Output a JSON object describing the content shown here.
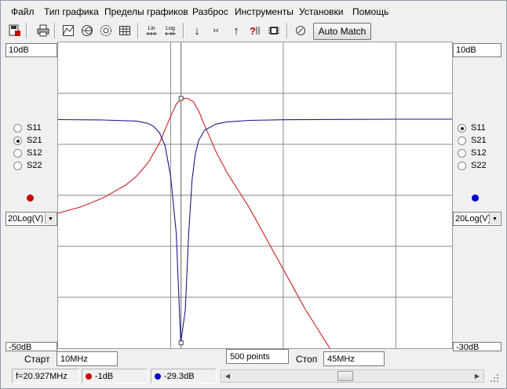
{
  "menu": [
    "Файл",
    "Тип графика",
    "Пределы графиков",
    "Разброс",
    "Инструменты",
    "Установки",
    "Помощь"
  ],
  "toolbar": {
    "auto_match": "Auto Match",
    "lin": "Lin",
    "log": "Log",
    "zoom": "?",
    "arrows": [
      "↓",
      "›‹",
      "↑"
    ]
  },
  "left": {
    "top_scale": "10dB",
    "bottom_scale": "-50dB",
    "params": [
      "S11",
      "S21",
      "S12",
      "S22"
    ],
    "selected": "S21",
    "marker_color": "#cc0000",
    "format": "20Log(V)"
  },
  "right": {
    "top_scale": "10dB",
    "bottom_scale": "-30dB",
    "params": [
      "S11",
      "S21",
      "S12",
      "S22"
    ],
    "selected": "S11",
    "marker_color": "#0000cc",
    "format": "20Log(V)"
  },
  "bottom": {
    "start_label": "Старт",
    "start_value": "10MHz",
    "points": "500 points",
    "stop_label": "Стоп",
    "stop_value": "45MHz"
  },
  "status": {
    "freq": "f=20.927MHz",
    "red_value": "-1dB",
    "blue_value": "-29.3dB"
  },
  "colors": {
    "s21_trace": "#cc2222",
    "s11_trace": "#1a1a8c",
    "grid": "#888888"
  },
  "chart_data": {
    "type": "line",
    "x_range": [
      10,
      45
    ],
    "x_unit": "MHz",
    "left_axis": {
      "ylim": [
        -50,
        10
      ],
      "unit": "dB"
    },
    "right_axis": {
      "ylim": [
        -30,
        10
      ],
      "unit": "dB"
    },
    "grid": true,
    "cursor_x": 20.927,
    "series": [
      {
        "param": "S21",
        "axis": "left",
        "color": "#cc2222",
        "x": [
          10,
          12,
          14,
          16,
          17,
          18,
          19,
          19.5,
          20,
          20.5,
          21,
          21.5,
          22,
          22.5,
          23,
          24,
          25,
          26,
          27,
          28,
          29,
          30,
          31,
          32,
          33,
          34,
          35,
          37
        ],
        "y": [
          -23.5,
          -22.3,
          -20.5,
          -18.0,
          -16.2,
          -13.6,
          -9.8,
          -7.1,
          -4.5,
          -2.1,
          -1.0,
          -1.0,
          -1.6,
          -3.5,
          -6.2,
          -11.3,
          -15.5,
          -19.0,
          -22.5,
          -26.5,
          -30.5,
          -34.5,
          -38.5,
          -42.5,
          -46.0,
          -49.5,
          -53.0,
          -60.0
        ]
      },
      {
        "param": "S11",
        "axis": "right",
        "color": "#1a1a8c",
        "x": [
          10,
          14,
          17,
          18,
          18.5,
          19,
          19.5,
          20,
          20.5,
          20.9,
          21.3,
          21.6,
          21.9,
          22.2,
          22.5,
          23,
          24,
          25,
          27,
          30,
          35,
          40,
          45
        ],
        "y": [
          -0.1,
          -0.15,
          -0.3,
          -0.6,
          -1.0,
          -1.8,
          -3.5,
          -7.5,
          -15.0,
          -29.3,
          -25.0,
          -15.0,
          -8.0,
          -4.5,
          -2.8,
          -1.5,
          -0.7,
          -0.4,
          -0.2,
          -0.12,
          -0.08,
          -0.05,
          -0.05
        ]
      }
    ]
  }
}
